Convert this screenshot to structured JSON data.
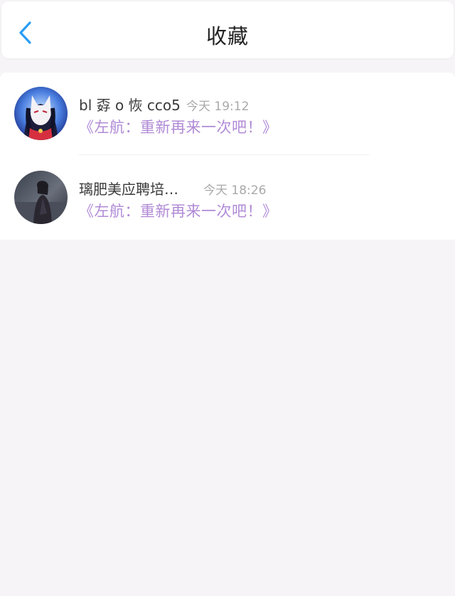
{
  "header": {
    "title": "收藏",
    "back_icon": "chevron-left-icon",
    "accent_color": "#2a9df4"
  },
  "favorites": [
    {
      "name": "bl 孬 o 恢 cco5",
      "time": "今天 19:12",
      "title": "《左航：重新再来一次吧！》",
      "avatar": "avatar-anime-fox-mask"
    },
    {
      "name": "璃肥美应聘培…",
      "time": "今天 18:26",
      "title": "《左航：重新再来一次吧！》",
      "avatar": "avatar-photo-person"
    }
  ],
  "colors": {
    "title_link": "#b08ad6",
    "page_bg": "#f6f4f6"
  }
}
